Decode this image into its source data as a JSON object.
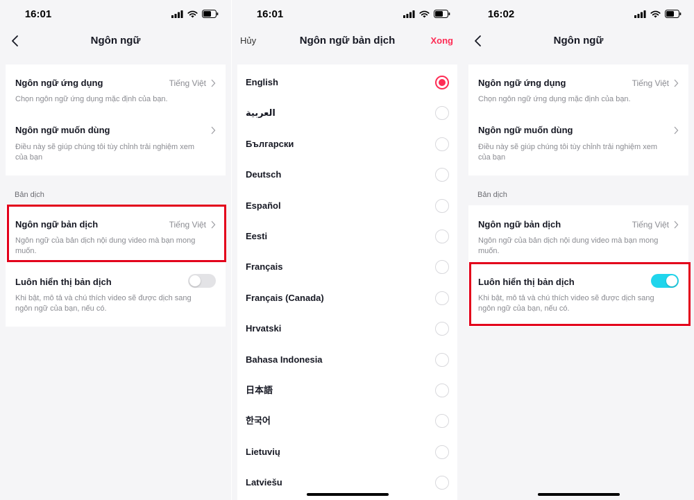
{
  "screen1": {
    "status": {
      "time": "16:01"
    },
    "nav": {
      "title": "Ngôn ngữ"
    },
    "app_language": {
      "title": "Ngôn ngữ ứng dụng",
      "value": "Tiếng Việt",
      "desc": "Chọn ngôn ngữ ứng dụng mặc định của bạn."
    },
    "preferred_language": {
      "title": "Ngôn ngữ muốn dùng",
      "desc": "Điều này sẽ giúp chúng tôi tùy chỉnh trải nghiệm xem của bạn"
    },
    "section_label": "Bản dịch",
    "translation_language": {
      "title": "Ngôn ngữ bản dịch",
      "value": "Tiếng Việt",
      "desc": "Ngôn ngữ của bản dịch nội dung video mà bạn mong muốn."
    },
    "always_show": {
      "title": "Luôn hiển thị bản dịch",
      "desc": "Khi bật, mô tả và chú thích video sẽ được dịch sang ngôn ngữ của bạn, nếu có.",
      "enabled": false
    }
  },
  "screen2": {
    "status": {
      "time": "16:01"
    },
    "nav": {
      "cancel": "Hủy",
      "title": "Ngôn ngữ bản dịch",
      "done": "Xong"
    },
    "languages": [
      {
        "name": "English",
        "selected": true
      },
      {
        "name": "العربية",
        "selected": false
      },
      {
        "name": "Български",
        "selected": false
      },
      {
        "name": "Deutsch",
        "selected": false
      },
      {
        "name": "Español",
        "selected": false
      },
      {
        "name": "Eesti",
        "selected": false
      },
      {
        "name": "Français",
        "selected": false
      },
      {
        "name": "Français (Canada)",
        "selected": false
      },
      {
        "name": "Hrvatski",
        "selected": false
      },
      {
        "name": "Bahasa Indonesia",
        "selected": false
      },
      {
        "name": "日本語",
        "selected": false
      },
      {
        "name": "한국어",
        "selected": false
      },
      {
        "name": "Lietuvių",
        "selected": false
      },
      {
        "name": "Latviešu",
        "selected": false
      }
    ]
  },
  "screen3": {
    "status": {
      "time": "16:02"
    },
    "nav": {
      "title": "Ngôn ngữ"
    },
    "app_language": {
      "title": "Ngôn ngữ ứng dụng",
      "value": "Tiếng Việt",
      "desc": "Chọn ngôn ngữ ứng dụng mặc định của bạn."
    },
    "preferred_language": {
      "title": "Ngôn ngữ muốn dùng",
      "desc": "Điều này sẽ giúp chúng tôi tùy chỉnh trải nghiệm xem của bạn"
    },
    "section_label": "Bản dịch",
    "translation_language": {
      "title": "Ngôn ngữ bản dịch",
      "value": "Tiếng Việt",
      "desc": "Ngôn ngữ của bản dịch nội dung video mà bạn mong muốn."
    },
    "always_show": {
      "title": "Luôn hiển thị bản dịch",
      "desc": "Khi bật, mô tả và chú thích video sẽ được dịch sang ngôn ngữ của bạn, nếu có.",
      "enabled": true
    }
  },
  "colors": {
    "accent_red": "#fe2c55",
    "toggle_on": "#20d5ec",
    "highlight": "#e3001b"
  }
}
